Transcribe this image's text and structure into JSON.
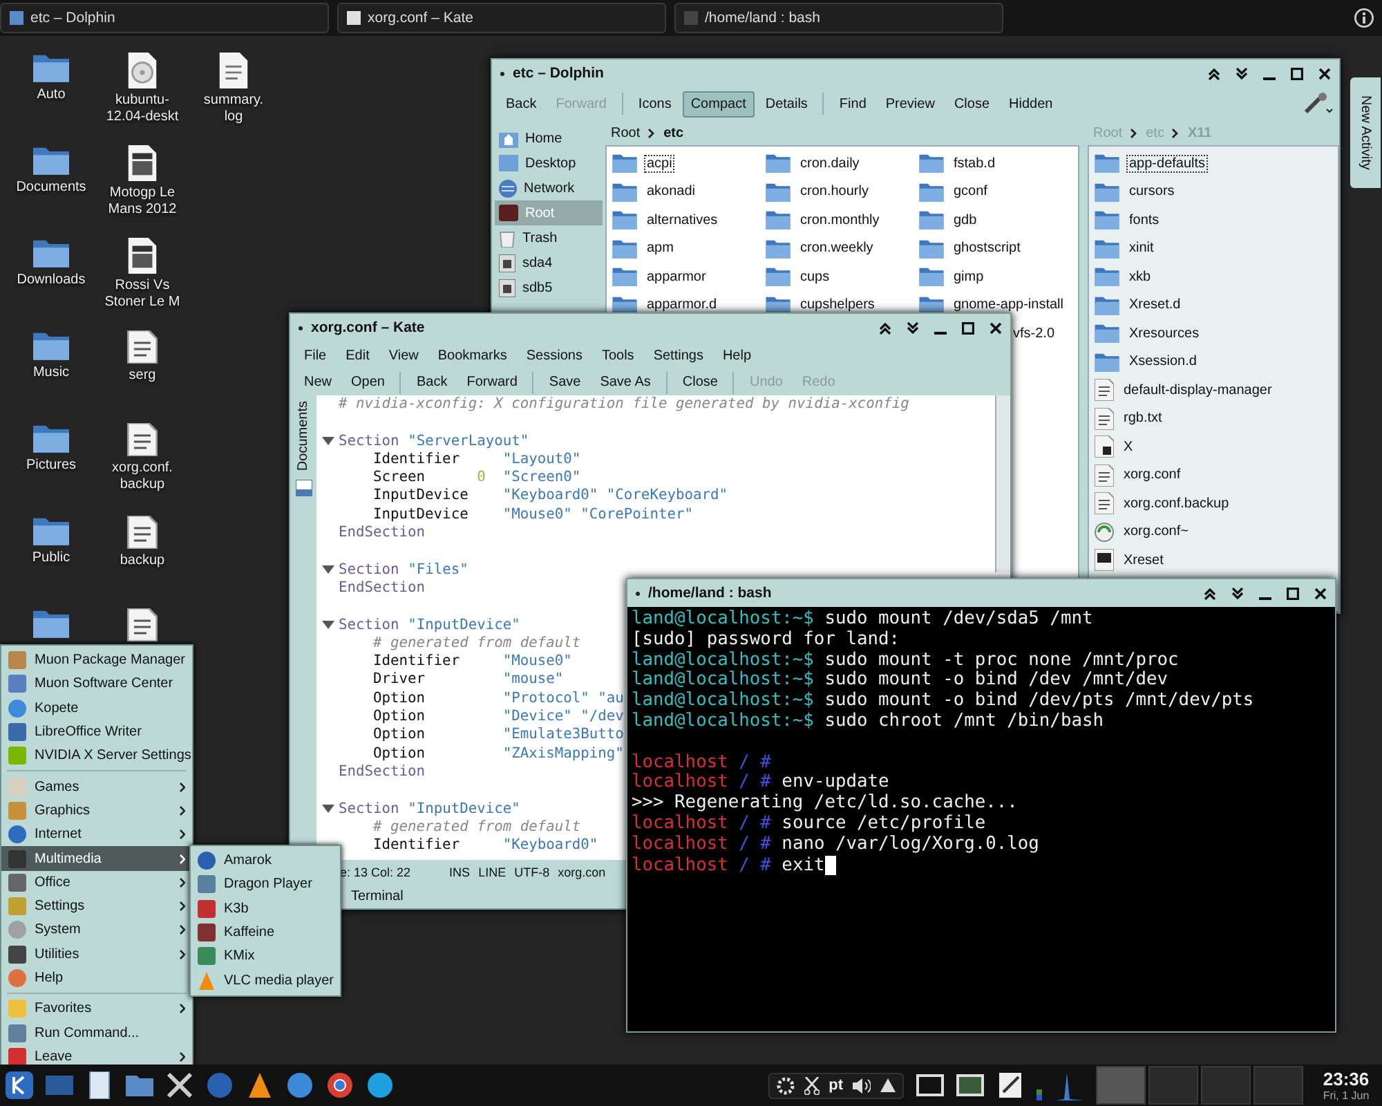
{
  "top_bar": {
    "tasks": [
      {
        "title": "etc – Dolphin",
        "kind": "files"
      },
      {
        "title": "xorg.conf – Kate",
        "kind": "editor"
      },
      {
        "title": "/home/land : bash",
        "kind": "terminal"
      }
    ]
  },
  "desktop_columns": [
    [
      {
        "kind": "folder",
        "lines": [
          "Auto"
        ]
      },
      {
        "kind": "folder",
        "lines": [
          "Documents"
        ]
      },
      {
        "kind": "folder",
        "lines": [
          "Downloads"
        ]
      },
      {
        "kind": "folder",
        "lines": [
          "Music"
        ]
      },
      {
        "kind": "folder",
        "lines": [
          "Pictures"
        ]
      },
      {
        "kind": "folder",
        "lines": [
          "Public"
        ]
      },
      {
        "kind": "folder"
      }
    ],
    [
      {
        "kind": "disc",
        "lines": [
          "kubuntu-",
          "12.04-deskt"
        ]
      },
      {
        "kind": "video",
        "lines": [
          "Motogp Le",
          "Mans 2012"
        ]
      },
      {
        "kind": "video",
        "lines": [
          "Rossi Vs",
          "Stoner Le M"
        ]
      },
      {
        "kind": "text",
        "lines": [
          "serg"
        ]
      },
      {
        "kind": "text",
        "lines": [
          "xorg.conf.",
          "backup"
        ]
      },
      {
        "kind": "text",
        "lines": [
          "backup"
        ]
      },
      {
        "kind": "text"
      }
    ],
    [
      {
        "kind": "log",
        "lines": [
          "summary.",
          "log"
        ]
      }
    ]
  ],
  "dolphin": {
    "title": "etc – Dolphin",
    "toolbar": [
      {
        "label": "Back",
        "disabled": false,
        "selected": false,
        "separator_after": false
      },
      {
        "label": "Forward",
        "disabled": true,
        "selected": false,
        "separator_after": true
      },
      {
        "label": "Icons",
        "disabled": false,
        "selected": false,
        "separator_after": false
      },
      {
        "label": "Compact",
        "disabled": false,
        "selected": true,
        "separator_after": false
      },
      {
        "label": "Details",
        "disabled": false,
        "selected": false,
        "separator_after": true
      },
      {
        "label": "Find",
        "disabled": false,
        "selected": false,
        "separator_after": false
      },
      {
        "label": "Preview",
        "disabled": false,
        "selected": false,
        "separator_after": false
      },
      {
        "label": "Close",
        "disabled": false,
        "selected": false,
        "separator_after": false
      },
      {
        "label": "Hidden",
        "disabled": false,
        "selected": false,
        "separator_after": false
      }
    ],
    "places": [
      {
        "label": "Home",
        "kind": "home",
        "selected": false
      },
      {
        "label": "Desktop",
        "kind": "desktop",
        "selected": false
      },
      {
        "label": "Network",
        "kind": "network",
        "selected": false
      },
      {
        "label": "Root",
        "kind": "root",
        "selected": true
      },
      {
        "label": "Trash",
        "kind": "trash",
        "selected": false
      },
      {
        "label": "sda4",
        "kind": "drive",
        "selected": false
      },
      {
        "label": "sdb5",
        "kind": "drive",
        "selected": false
      }
    ],
    "breadcrumb": [
      "Root",
      "etc"
    ],
    "file_columns": [
      [
        {
          "name": "acpi",
          "kind": "folder",
          "focused": true
        },
        {
          "name": "akonadi",
          "kind": "folder",
          "focused": false
        },
        {
          "name": "alternatives",
          "kind": "folder",
          "focused": false
        },
        {
          "name": "apm",
          "kind": "folder",
          "focused": false
        },
        {
          "name": "apparmor",
          "kind": "folder",
          "focused": false
        },
        {
          "name": "apparmor.d",
          "kind": "folder",
          "focused": false
        }
      ],
      [
        {
          "name": "cron.daily",
          "kind": "folder",
          "focused": false
        },
        {
          "name": "cron.hourly",
          "kind": "folder",
          "focused": false
        },
        {
          "name": "cron.monthly",
          "kind": "folder",
          "focused": false
        },
        {
          "name": "cron.weekly",
          "kind": "folder",
          "focused": false
        },
        {
          "name": "cups",
          "kind": "folder",
          "focused": false
        },
        {
          "name": "cupshelpers",
          "kind": "folder",
          "focused": false
        }
      ],
      [
        {
          "name": "fstab.d",
          "kind": "folder",
          "focused": false
        },
        {
          "name": "gconf",
          "kind": "folder",
          "focused": false
        },
        {
          "name": "gdb",
          "kind": "folder",
          "focused": false
        },
        {
          "name": "ghostscript",
          "kind": "folder",
          "focused": false
        },
        {
          "name": "gimp",
          "kind": "folder",
          "focused": false
        },
        {
          "name": "gnome-app-install",
          "kind": "folder",
          "focused": false
        },
        {
          "name": "vfs-2.0",
          "kind": "partial",
          "focused": false
        }
      ]
    ],
    "split_breadcrumb": [
      "Root",
      "etc",
      "X11"
    ],
    "split_files": [
      {
        "name": "app-defaults",
        "kind": "folder",
        "focused": true
      },
      {
        "name": "cursors",
        "kind": "folder",
        "focused": false
      },
      {
        "name": "fonts",
        "kind": "folder",
        "focused": false
      },
      {
        "name": "xinit",
        "kind": "folder",
        "focused": false
      },
      {
        "name": "xkb",
        "kind": "folder",
        "focused": false
      },
      {
        "name": "Xreset.d",
        "kind": "folder",
        "focused": false
      },
      {
        "name": "Xresources",
        "kind": "folder",
        "focused": false
      },
      {
        "name": "Xsession.d",
        "kind": "folder",
        "focused": false
      },
      {
        "name": "default-display-manager",
        "kind": "text",
        "focused": false
      },
      {
        "name": "rgb.txt",
        "kind": "text",
        "focused": false
      },
      {
        "name": "X",
        "kind": "binary",
        "focused": false
      },
      {
        "name": "xorg.conf",
        "kind": "text",
        "focused": false
      },
      {
        "name": "xorg.conf.backup",
        "kind": "text",
        "focused": false
      },
      {
        "name": "xorg.conf~",
        "kind": "backup",
        "focused": false
      },
      {
        "name": "Xreset",
        "kind": "script",
        "focused": false
      }
    ]
  },
  "kate": {
    "title": "xorg.conf – Kate",
    "menu": [
      "File",
      "Edit",
      "View",
      "Bookmarks",
      "Sessions",
      "Tools",
      "Settings",
      "Help"
    ],
    "toolbar": [
      {
        "label": "New",
        "disabled": false,
        "separator_after": false
      },
      {
        "label": "Open",
        "disabled": false,
        "separator_after": true
      },
      {
        "label": "Back",
        "disabled": false,
        "separator_after": false
      },
      {
        "label": "Forward",
        "disabled": false,
        "separator_after": true
      },
      {
        "label": "Save",
        "disabled": false,
        "separator_after": false
      },
      {
        "label": "Save As",
        "disabled": false,
        "separator_after": true
      },
      {
        "label": "Close",
        "disabled": false,
        "separator_after": true
      },
      {
        "label": "Undo",
        "disabled": true,
        "separator_after": false
      },
      {
        "label": "Redo",
        "disabled": true,
        "separator_after": false
      }
    ],
    "side_tab": "Documents",
    "lines": [
      {
        "kind": "comment",
        "text": "# nvidia-xconfig: X configuration file generated by nvidia-xconfig"
      },
      {
        "kind": "blank"
      },
      {
        "kind": "section",
        "keyword": "Section",
        "value": "\"ServerLayout\""
      },
      {
        "kind": "entry",
        "key": "Identifier",
        "value": "\"Layout0\""
      },
      {
        "kind": "entry",
        "key": "Screen",
        "num": "0",
        "value": "\"Screen0\""
      },
      {
        "kind": "entry",
        "key": "InputDevice",
        "value": "\"Keyboard0\" \"CoreKeyboard\""
      },
      {
        "kind": "entry",
        "key": "InputDevice",
        "value": "\"Mouse0\" \"CorePointer\""
      },
      {
        "kind": "end",
        "keyword": "EndSection"
      },
      {
        "kind": "blank"
      },
      {
        "kind": "section",
        "keyword": "Section",
        "value": "\"Files\""
      },
      {
        "kind": "end",
        "keyword": "EndSection"
      },
      {
        "kind": "blank"
      },
      {
        "kind": "section",
        "keyword": "Section",
        "value": "\"InputDevice\""
      },
      {
        "kind": "note",
        "text": "# generated from default"
      },
      {
        "kind": "entry",
        "key": "Identifier",
        "value": "\"Mouse0\""
      },
      {
        "kind": "entry",
        "key": "Driver",
        "value": "\"mouse\""
      },
      {
        "kind": "entry",
        "key": "Option",
        "value": "\"Protocol\" \"au"
      },
      {
        "kind": "entry",
        "key": "Option",
        "value": "\"Device\" \"/dev"
      },
      {
        "kind": "entry",
        "key": "Option",
        "value": "\"Emulate3Butto"
      },
      {
        "kind": "entry",
        "key": "Option",
        "value": "\"ZAxisMapping\""
      },
      {
        "kind": "end",
        "keyword": "EndSection"
      },
      {
        "kind": "blank"
      },
      {
        "kind": "section",
        "keyword": "Section",
        "value": "\"InputDevice\""
      },
      {
        "kind": "note",
        "text": "# generated from default"
      },
      {
        "kind": "entry",
        "key": "Identifier",
        "value": "\"Keyboard0\""
      }
    ],
    "status": [
      "e: 13 Col: 22",
      "INS",
      "LINE",
      "UTF-8",
      "xorg.con"
    ],
    "bottom_tabs": [
      "Terminal"
    ]
  },
  "terminal": {
    "title": "/home/land : bash",
    "cursor_visible": true,
    "lines": [
      {
        "kind": "user",
        "prompt": "land@localhost:~$",
        "command": "sudo mount /dev/sda5 /mnt"
      },
      {
        "kind": "output",
        "text": "[sudo] password for land:"
      },
      {
        "kind": "user",
        "prompt": "land@localhost:~$",
        "command": "sudo mount -t proc none /mnt/proc"
      },
      {
        "kind": "user",
        "prompt": "land@localhost:~$",
        "command": "sudo mount -o bind /dev /mnt/dev"
      },
      {
        "kind": "user",
        "prompt": "land@localhost:~$",
        "command": "sudo mount -o bind /dev/pts /mnt/dev/pts"
      },
      {
        "kind": "user",
        "prompt": "land@localhost:~$",
        "command": "sudo chroot /mnt /bin/bash"
      },
      {
        "kind": "blank"
      },
      {
        "kind": "root",
        "host": "localhost",
        "marker": "/ #"
      },
      {
        "kind": "root",
        "host": "localhost",
        "marker": "/ #",
        "command": "env-update"
      },
      {
        "kind": "output",
        "text": ">>> Regenerating /etc/ld.so.cache..."
      },
      {
        "kind": "root",
        "host": "localhost",
        "marker": "/ #",
        "command": "source /etc/profile"
      },
      {
        "kind": "root",
        "host": "localhost",
        "marker": "/ #",
        "command": "nano /var/log/Xorg.0.log"
      },
      {
        "kind": "root",
        "host": "localhost",
        "marker": "/ #",
        "command": "exit"
      }
    ]
  },
  "activity_tab": "New Activity",
  "start_menu": {
    "sections": [
      [
        {
          "label": "Muon Package Manager",
          "kind": "package",
          "submenu": false,
          "selected": false
        },
        {
          "label": "Muon Software Center",
          "kind": "software",
          "submenu": false,
          "selected": false
        },
        {
          "label": "Kopete",
          "kind": "chat",
          "submenu": false,
          "selected": false
        },
        {
          "label": "LibreOffice Writer",
          "kind": "writer",
          "submenu": false,
          "selected": false
        },
        {
          "label": "NVIDIA X Server Settings",
          "kind": "nvidia",
          "submenu": false,
          "selected": false
        }
      ],
      [
        {
          "label": "Games",
          "kind": "games",
          "submenu": true,
          "selected": false
        },
        {
          "label": "Graphics",
          "kind": "graphics",
          "submenu": true,
          "selected": false
        },
        {
          "label": "Internet",
          "kind": "internet",
          "submenu": true,
          "selected": false
        },
        {
          "label": "Multimedia",
          "kind": "multimedia",
          "submenu": true,
          "selected": true
        },
        {
          "label": "Office",
          "kind": "office",
          "submenu": true,
          "selected": false
        },
        {
          "label": "Settings",
          "kind": "settings",
          "submenu": true,
          "selected": false
        },
        {
          "label": "System",
          "kind": "system",
          "submenu": true,
          "selected": false
        },
        {
          "label": "Utilities",
          "kind": "utilities",
          "submenu": true,
          "selected": false
        },
        {
          "label": "Help",
          "kind": "help",
          "submenu": false,
          "selected": false
        }
      ],
      [
        {
          "label": "Favorites",
          "kind": "favorites",
          "submenu": true,
          "selected": false
        },
        {
          "label": "Run Command...",
          "kind": "run",
          "submenu": false,
          "selected": false
        },
        {
          "label": "Leave",
          "kind": "leave",
          "submenu": true,
          "selected": false
        }
      ]
    ],
    "submenu": [
      {
        "label": "Amarok",
        "kind": "amarok"
      },
      {
        "label": "Dragon Player",
        "kind": "dragon"
      },
      {
        "label": "K3b",
        "kind": "k3b"
      },
      {
        "label": "Kaffeine",
        "kind": "kaffeine"
      },
      {
        "label": "KMix",
        "kind": "kmix"
      },
      {
        "label": "VLC media player",
        "kind": "vlc"
      }
    ]
  },
  "panel": {
    "language": "pt",
    "clock": {
      "time": "23:36",
      "date": "Fri, 1 Jun"
    }
  }
}
